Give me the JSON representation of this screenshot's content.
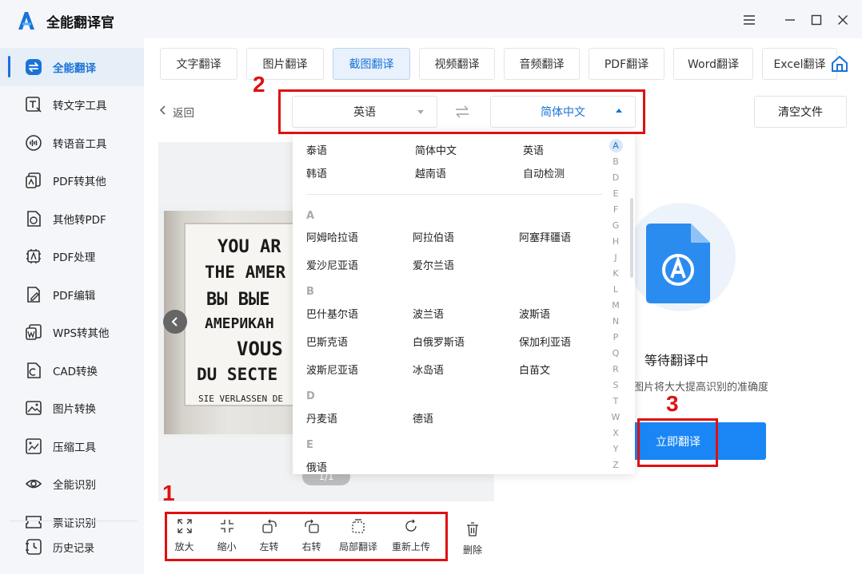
{
  "app": {
    "title": "全能翻译官",
    "accent": "#1a73d9"
  },
  "sidebar": {
    "items": [
      {
        "label": "全能翻译",
        "icon": "translate-icon",
        "active": true
      },
      {
        "label": "转文字工具",
        "icon": "text-convert-icon"
      },
      {
        "label": "转语音工具",
        "icon": "voice-icon"
      },
      {
        "label": "PDF转其他",
        "icon": "pdf-convert-icon"
      },
      {
        "label": "其他转PDF",
        "icon": "to-pdf-icon"
      },
      {
        "label": "PDF处理",
        "icon": "pdf-process-icon"
      },
      {
        "label": "PDF编辑",
        "icon": "pdf-edit-icon"
      },
      {
        "label": "WPS转其他",
        "icon": "wps-icon"
      },
      {
        "label": "CAD转换",
        "icon": "cad-icon"
      },
      {
        "label": "图片转换",
        "icon": "image-convert-icon"
      },
      {
        "label": "压缩工具",
        "icon": "compress-icon"
      },
      {
        "label": "全能识别",
        "icon": "recognize-icon"
      },
      {
        "label": "票证识别",
        "icon": "ticket-icon"
      }
    ],
    "history_label": "历史记录"
  },
  "tabs": [
    {
      "label": "文字翻译"
    },
    {
      "label": "图片翻译"
    },
    {
      "label": "截图翻译",
      "active": true
    },
    {
      "label": "视频翻译"
    },
    {
      "label": "音频翻译"
    },
    {
      "label": "PDF翻译"
    },
    {
      "label": "Word翻译"
    },
    {
      "label": "Excel翻译"
    }
  ],
  "back_label": "返回",
  "clear_label": "清空文件",
  "source_lang": "英语",
  "target_lang": "简体中文",
  "dropdown": {
    "recent": [
      [
        "泰语",
        "简体中文",
        "英语"
      ],
      [
        "韩语",
        "越南语",
        "自动检测"
      ]
    ],
    "groups": [
      {
        "letter": "A",
        "rows": [
          [
            "阿姆哈拉语",
            "阿拉伯语",
            "阿塞拜疆语"
          ],
          [
            "爱沙尼亚语",
            "爱尔兰语"
          ]
        ]
      },
      {
        "letter": "B",
        "rows": [
          [
            "巴什基尔语",
            "波兰语",
            "波斯语"
          ],
          [
            "巴斯克语",
            "白俄罗斯语",
            "保加利亚语"
          ],
          [
            "波斯尼亚语",
            "冰岛语",
            "白苗文"
          ]
        ]
      },
      {
        "letter": "D",
        "rows": [
          [
            "丹麦语",
            "德语"
          ]
        ]
      },
      {
        "letter": "E",
        "rows": [
          [
            "俄语"
          ]
        ]
      }
    ],
    "alphabet": [
      "A",
      "B",
      "D",
      "E",
      "F",
      "G",
      "H",
      "J",
      "K",
      "L",
      "M",
      "N",
      "P",
      "Q",
      "R",
      "S",
      "T",
      "W",
      "X",
      "Y",
      "Z"
    ]
  },
  "preview": {
    "sign_lines": [
      "YOU AR",
      "THE AMER",
      "ВЫ ВЫЕ",
      "АМЕРИКАН",
      "VOUS",
      "DU SECTE",
      "SIE VERLASSEN DE"
    ],
    "pager": "1/1"
  },
  "toolbar": {
    "tools": [
      {
        "label": "放大",
        "icon": "zoom-in-icon"
      },
      {
        "label": "缩小",
        "icon": "zoom-out-icon"
      },
      {
        "label": "左转",
        "icon": "rotate-left-icon"
      },
      {
        "label": "右转",
        "icon": "rotate-right-icon"
      },
      {
        "label": "局部翻译",
        "icon": "partial-translate-icon"
      },
      {
        "label": "重新上传",
        "icon": "reupload-icon"
      }
    ],
    "delete_label": "删除"
  },
  "status": {
    "title": "等待翻译中",
    "subtitle": "图片将大大提高识别的准确度",
    "action_label": "立即翻译"
  },
  "annotations": [
    "1",
    "2",
    "3"
  ]
}
